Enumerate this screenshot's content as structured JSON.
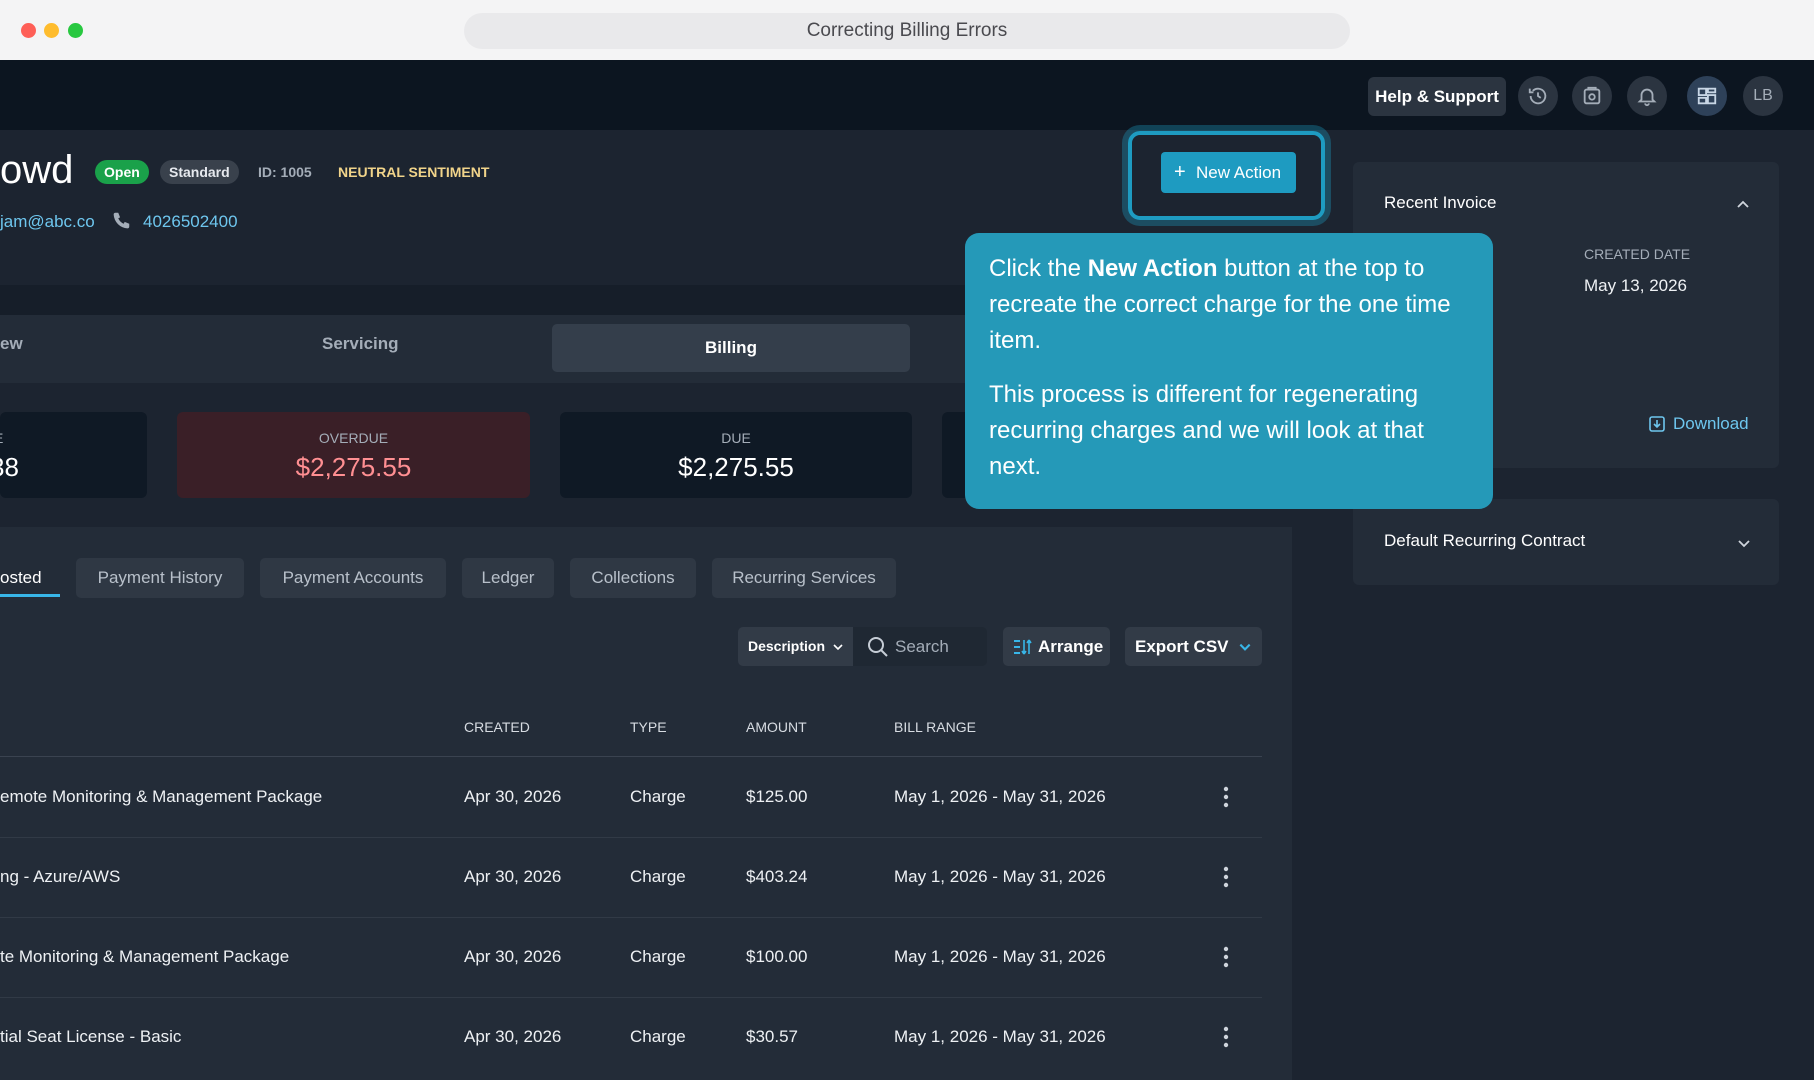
{
  "window": {
    "title": "Correcting Billing Errors"
  },
  "topbar": {
    "help_label": "Help & Support",
    "avatar_initials": "LB"
  },
  "customer": {
    "name_fragment": "owd",
    "status_badge": "Open",
    "plan_badge": "Standard",
    "id_label": "ID: 1005",
    "sentiment": "NEUTRAL SENTIMENT",
    "email_fragment": "jam@abc.co",
    "phone": "4026502400"
  },
  "actions": {
    "new_action_label": "New Action"
  },
  "tabs": [
    {
      "label": "ew"
    },
    {
      "label": "Servicing"
    },
    {
      "label": "Billing",
      "active": true
    }
  ],
  "stats": [
    {
      "label": "E",
      "value": "38"
    },
    {
      "label": "OVERDUE",
      "value": "$2,275.55",
      "color": "#ff8f92"
    },
    {
      "label": "DUE",
      "value": "$2,275.55"
    }
  ],
  "subtabs": [
    {
      "label": "osted",
      "active": true
    },
    {
      "label": "Payment History"
    },
    {
      "label": "Payment Accounts"
    },
    {
      "label": "Ledger"
    },
    {
      "label": "Collections"
    },
    {
      "label": "Recurring Services"
    }
  ],
  "toolbar": {
    "filter_field": "Description",
    "search_placeholder": "Search",
    "arrange_label": "Arrange",
    "export_label": "Export CSV"
  },
  "table": {
    "columns": [
      "CREATED",
      "TYPE",
      "AMOUNT",
      "BILL RANGE"
    ],
    "rows": [
      {
        "description": "emote Monitoring & Management Package",
        "created": "Apr 30, 2026",
        "type": "Charge",
        "amount": "$125.00",
        "bill_range": "May 1, 2026 - May 31, 2026"
      },
      {
        "description": "ng - Azure/AWS",
        "created": "Apr 30, 2026",
        "type": "Charge",
        "amount": "$403.24",
        "bill_range": "May 1, 2026 - May 31, 2026"
      },
      {
        "description": "te Monitoring & Management Package",
        "created": "Apr 30, 2026",
        "type": "Charge",
        "amount": "$100.00",
        "bill_range": "May 1, 2026 - May 31, 2026"
      },
      {
        "description": "tial Seat License - Basic",
        "created": "Apr 30, 2026",
        "type": "Charge",
        "amount": "$30.57",
        "bill_range": "May 1, 2026 - May 31, 2026"
      }
    ]
  },
  "right_panel": {
    "recent_invoice": {
      "title": "Recent Invoice",
      "created_date_label": "CREATED DATE",
      "created_date_value": "May 13, 2026",
      "download_label": "Download"
    },
    "default_contract": {
      "title": "Default Recurring Contract"
    }
  },
  "tooltip": {
    "p1_before": "Click the ",
    "p1_bold": "New Action",
    "p1_after": " button at the top to recreate the correct charge for the one time item.",
    "p2": "This process is different for regenerating recurring charges and we will look at that next."
  },
  "colors": {
    "accent": "#1e9bc1",
    "link": "#6ec6ee",
    "overdue": "#ff8f92",
    "open_badge": "#1aa14a",
    "sentiment": "#f1d48a"
  }
}
